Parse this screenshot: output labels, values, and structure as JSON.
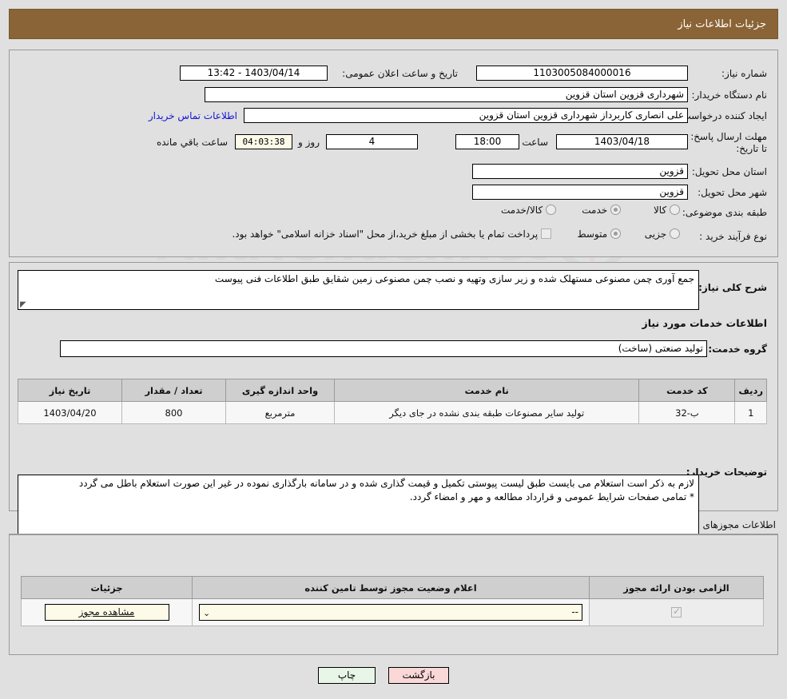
{
  "header": {
    "title": "جزئیات اطلاعات نیاز"
  },
  "top": {
    "need_number_label": "شماره نیاز:",
    "need_number_value": "1103005084000016",
    "announce_label": "تاریخ و ساعت اعلان عمومی:",
    "announce_value": "1403/04/14 - 13:42",
    "buyer_org_label": "نام دستگاه خریدار:",
    "buyer_org_value": "شهرداری قزوین استان قزوین",
    "requester_label": "ایجاد کننده درخواست:",
    "requester_value": "علی انصاری کاربرداز شهرداری قزوین استان قزوین",
    "contact_link": "اطلاعات تماس خریدار",
    "deadline_label": "مهلت ارسال پاسخ: تا تاریخ:",
    "deadline_date": "1403/04/18",
    "hour_label": "ساعت",
    "deadline_time": "18:00",
    "days_value": "4",
    "days_label": "روز و",
    "timer_value": "04:03:38",
    "remaining_label": "ساعت باقي مانده",
    "province_label": "استان محل تحویل:",
    "province_value": "قزوین",
    "city_label": "شهر محل تحویل:",
    "city_value": "قزوین",
    "category_label": "طبقه بندی موضوعی:",
    "category_options": [
      {
        "label": "کالا",
        "selected": false
      },
      {
        "label": "خدمت",
        "selected": true
      },
      {
        "label": "کالا/خدمت",
        "selected": false
      }
    ],
    "process_label": "نوع فرآیند خرید :",
    "process_options": [
      {
        "label": "جزیی",
        "selected": false
      },
      {
        "label": "متوسط",
        "selected": true
      }
    ],
    "treasury_checked": false,
    "treasury_note": "پرداخت تمام یا بخشی از مبلغ خرید،از محل \"اسناد خزانه اسلامی\" خواهد بود."
  },
  "mid": {
    "need_desc_label": "شرح کلی نیاز:",
    "need_desc_value": "جمع آوری چمن مصنوعی مستهلک شده و زیر سازی وتهیه و نصب چمن مصنوعی زمین شقایق طبق اطلاعات فنی پیوست",
    "services_heading": "اطلاعات خدمات مورد نیاز",
    "service_group_label": "گروه خدمت:",
    "service_group_value": "تولید صنعتی (ساخت)",
    "table_headers": [
      "ردیف",
      "کد خدمت",
      "نام خدمت",
      "واحد اندازه گیری",
      "تعداد / مقدار",
      "تاریخ نیاز"
    ],
    "table_rows": [
      {
        "row": "1",
        "code": "ب-32",
        "name": "تولید سایر مصنوعات طبقه بندی نشده در جای دیگر",
        "unit": "مترمربع",
        "qty": "800",
        "date": "1403/04/20"
      }
    ],
    "buyer_notes_label": "توضیحات خریدار:",
    "buyer_notes_lines": [
      "لازم به ذکر است استعلام می بایست طبق لیست پیوستی تکمیل و قیمت گذاری شده و در سامانه بارگذاری نموده در غیر این صورت استعلام باطل می گردد",
      "* تمامی صفحات شرایط عمومی و قرارداد مطالعه  و مهر و امضاء گردد."
    ]
  },
  "bottom": {
    "permits_caption": "اطلاعات مجوزهای ارائه خدمت / کالا",
    "permits_headers": [
      "الزامی بودن ارائه مجوز",
      "اعلام وضعیت مجوز توسط تامین کننده",
      "جزئیات"
    ],
    "permits_rows": [
      {
        "required_checked": true,
        "status_value": "--",
        "details_label": "مشاهده مجوز"
      }
    ]
  },
  "footer": {
    "print_label": "چاپ",
    "back_label": "بازگشت"
  },
  "watermark": {
    "text": "AnaTender.net"
  },
  "colors": {
    "titlebar": "#8a6436",
    "link": "#1414d2",
    "print_button": "#e8f6e8",
    "back_button": "#fbd8d8",
    "timer_bg": "#fdfbe8"
  }
}
